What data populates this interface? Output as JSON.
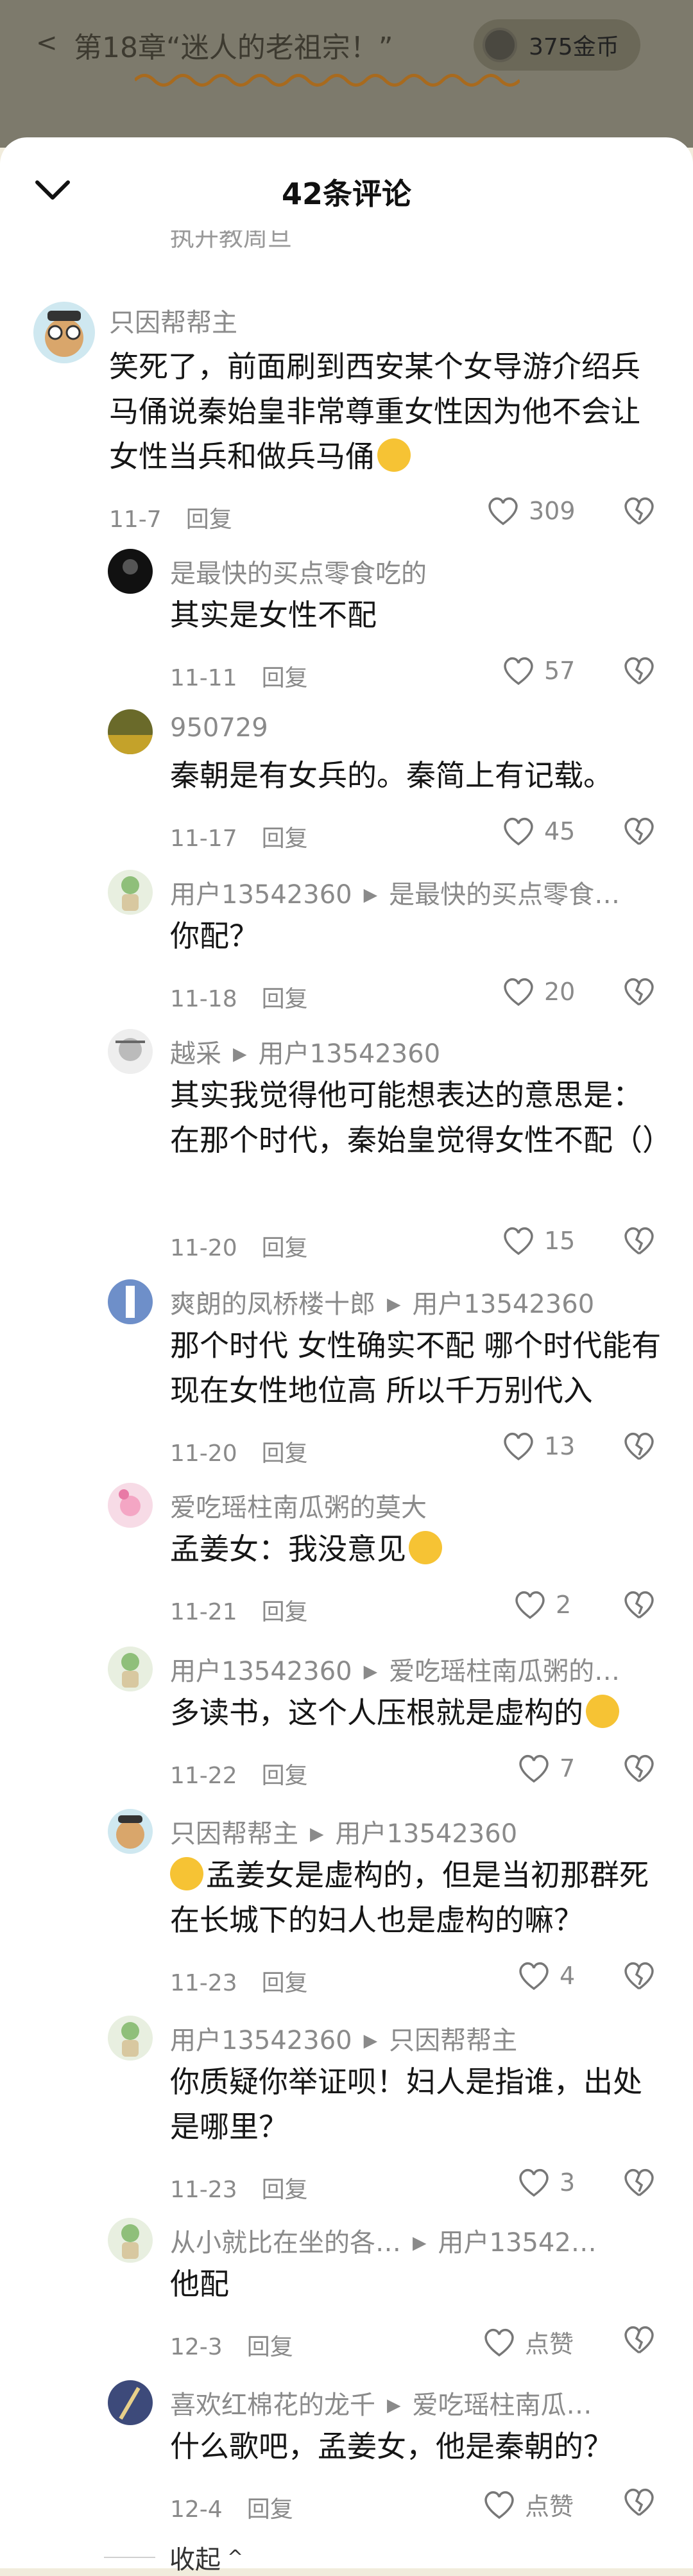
{
  "reader": {
    "back": "<",
    "chapter": "第18章“迷人的老祖宗！”",
    "coins": "375金币"
  },
  "sheet": {
    "title": "42条评论",
    "peek": "执开教周旦"
  },
  "icons": {
    "collapse": "chevron-down-icon",
    "like": "heart-icon",
    "dislike": "broken-heart-icon"
  },
  "colors": {
    "meta": "#8a8a8a",
    "text": "#161616",
    "sheet": "#ffffff",
    "reader_bg": "#7d7a6c"
  },
  "comments": [
    {
      "user": "只因帮帮主",
      "reply_to": "",
      "text": "笑死了，前面刷到西安某个女导游介绍兵马俑说秦始皇非常尊重女性因为他不会让女性当兵和做兵马俑",
      "date": "11-7",
      "reply": "回复",
      "likes": "309",
      "emoji": "smirk"
    },
    {
      "user": "是最快的买点零食吃的",
      "reply_to": "",
      "text": "其实是女性不配",
      "date": "11-11",
      "reply": "回复",
      "likes": "57"
    },
    {
      "user": "950729",
      "reply_to": "",
      "text": "秦朝是有女兵的。秦简上有记载。",
      "date": "11-17",
      "reply": "回复",
      "likes": "45"
    },
    {
      "user": "用户13542360",
      "reply_to": "是最快的买点零食…",
      "text": "你配？",
      "date": "11-18",
      "reply": "回复",
      "likes": "20"
    },
    {
      "user": "越采",
      "reply_to": "用户13542360",
      "text": "其实我觉得他可能想表达的意思是：在那个时代，秦始皇觉得女性不配（）",
      "date": "11-20",
      "reply": "回复",
      "likes": "15"
    },
    {
      "user": "爽朗的凤桥楼十郎",
      "reply_to": "用户13542360",
      "text": "那个时代 女性确实不配 哪个时代能有现在女性地位高 所以千万别代入",
      "date": "11-20",
      "reply": "回复",
      "likes": "13"
    },
    {
      "user": "爱吃瑶柱南瓜粥的莫大",
      "reply_to": "",
      "text": "孟姜女：我没意见",
      "date": "11-21",
      "reply": "回复",
      "likes": "2",
      "emoji": "cry"
    },
    {
      "user": "用户13542360",
      "reply_to": "爱吃瑶柱南瓜粥的…",
      "text": "多读书，这个人压根就是虚构的",
      "date": "11-22",
      "reply": "回复",
      "likes": "7",
      "emoji": "smile"
    },
    {
      "user": "只因帮帮主",
      "reply_to": "用户13542360",
      "text": "孟姜女是虚构的，但是当初那群死在长城下的妇人也是虚构的嘛？",
      "date": "11-23",
      "reply": "回复",
      "likes": "4",
      "emoji_lead": "laugh"
    },
    {
      "user": "用户13542360",
      "reply_to": "只因帮帮主",
      "text": "你质疑你举证呗！妇人是指谁，出处是哪里？",
      "date": "11-23",
      "reply": "回复",
      "likes": "3"
    },
    {
      "user": "从小就比在坐的各…",
      "reply_to": "用户13542…",
      "text": "他配",
      "date": "12-3",
      "reply": "回复",
      "likes": "点赞"
    },
    {
      "user": "喜欢红棉花的龙千",
      "reply_to": "爱吃瑶柱南瓜…",
      "text": "什么歌吧，孟姜女，他是秦朝的？",
      "date": "12-4",
      "reply": "回复",
      "likes": "点赞"
    }
  ],
  "fold": {
    "label": "收起",
    "chevron": "^"
  }
}
